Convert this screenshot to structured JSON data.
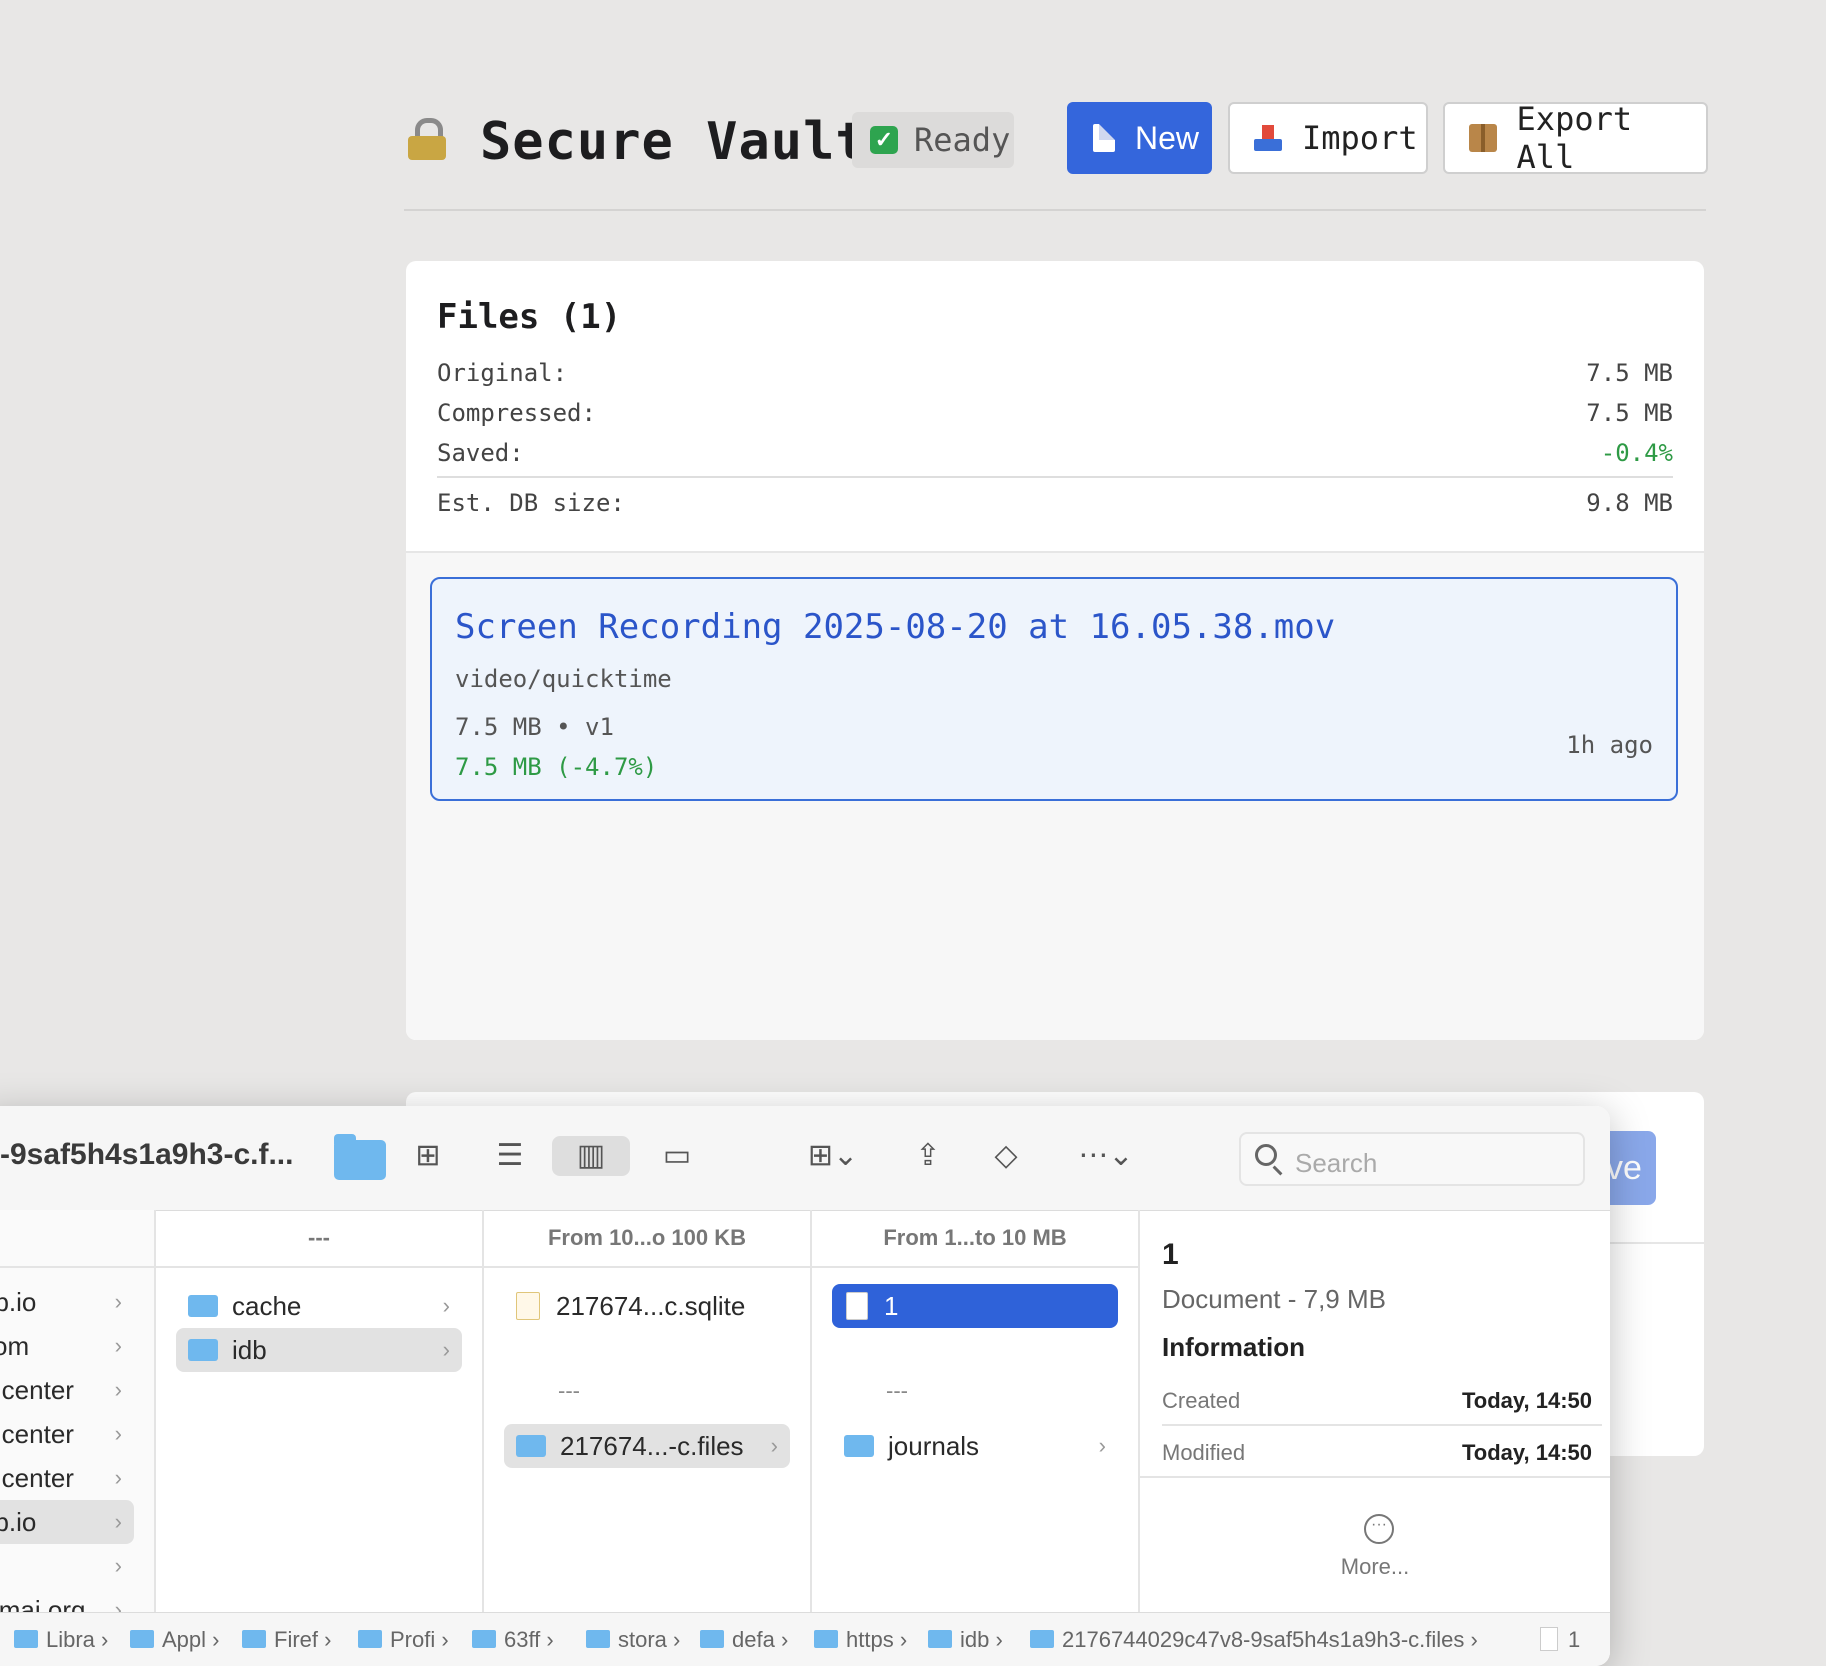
{
  "app": {
    "title": "Secure Vault",
    "status": "Ready",
    "buttons": {
      "new": "New",
      "import": "Import",
      "export_all": "Export All"
    }
  },
  "stats": {
    "heading": "Files (1)",
    "rows": [
      {
        "label": "Original:",
        "value": "7.5 MB"
      },
      {
        "label": "Compressed:",
        "value": "7.5 MB"
      },
      {
        "label": "Saved:",
        "value": "-0.4%"
      },
      {
        "label": "Est. DB size:",
        "value": "9.8 MB"
      }
    ]
  },
  "file_card": {
    "name": "Screen Recording 2025-08-20 at 16.05.38.mov",
    "mime": "video/quicktime",
    "meta": "7.5 MB • v1",
    "compressed": "7.5 MB (-4.7%)",
    "age": "1h ago"
  },
  "ghost_button": "ve",
  "finder": {
    "window_title": "-9saf5h4s1a9h3-c.f...",
    "search_placeholder": "Search",
    "sidebar": [
      "ub.io",
      "com",
      "e.center",
      "a.center",
      "e.center",
      "ub.io",
      "",
      "kimai.org"
    ],
    "col1": {
      "header": "---",
      "items": [
        "cache",
        "idb"
      ]
    },
    "col2": {
      "header": "From 10...o 100 KB",
      "file": "217674...c.sqlite",
      "divider": "---",
      "folder": "217674...-c.files"
    },
    "col3": {
      "header": "From 1...to 10 MB",
      "file": "1",
      "divider": "---",
      "folder": "journals"
    },
    "preview": {
      "name": "1",
      "kind": "Document - 7,9 MB",
      "info_heading": "Information",
      "created_label": "Created",
      "created_value": "Today, 14:50",
      "modified_label": "Modified",
      "modified_value": "Today, 14:50",
      "more": "More..."
    },
    "path": [
      "Libra",
      "Appl",
      "Firef",
      "Profi",
      "63ff",
      "stora",
      "defa",
      "https",
      "idb",
      "2176744029c47v8-9saf5h4s1a9h3-c.files",
      "1"
    ]
  }
}
